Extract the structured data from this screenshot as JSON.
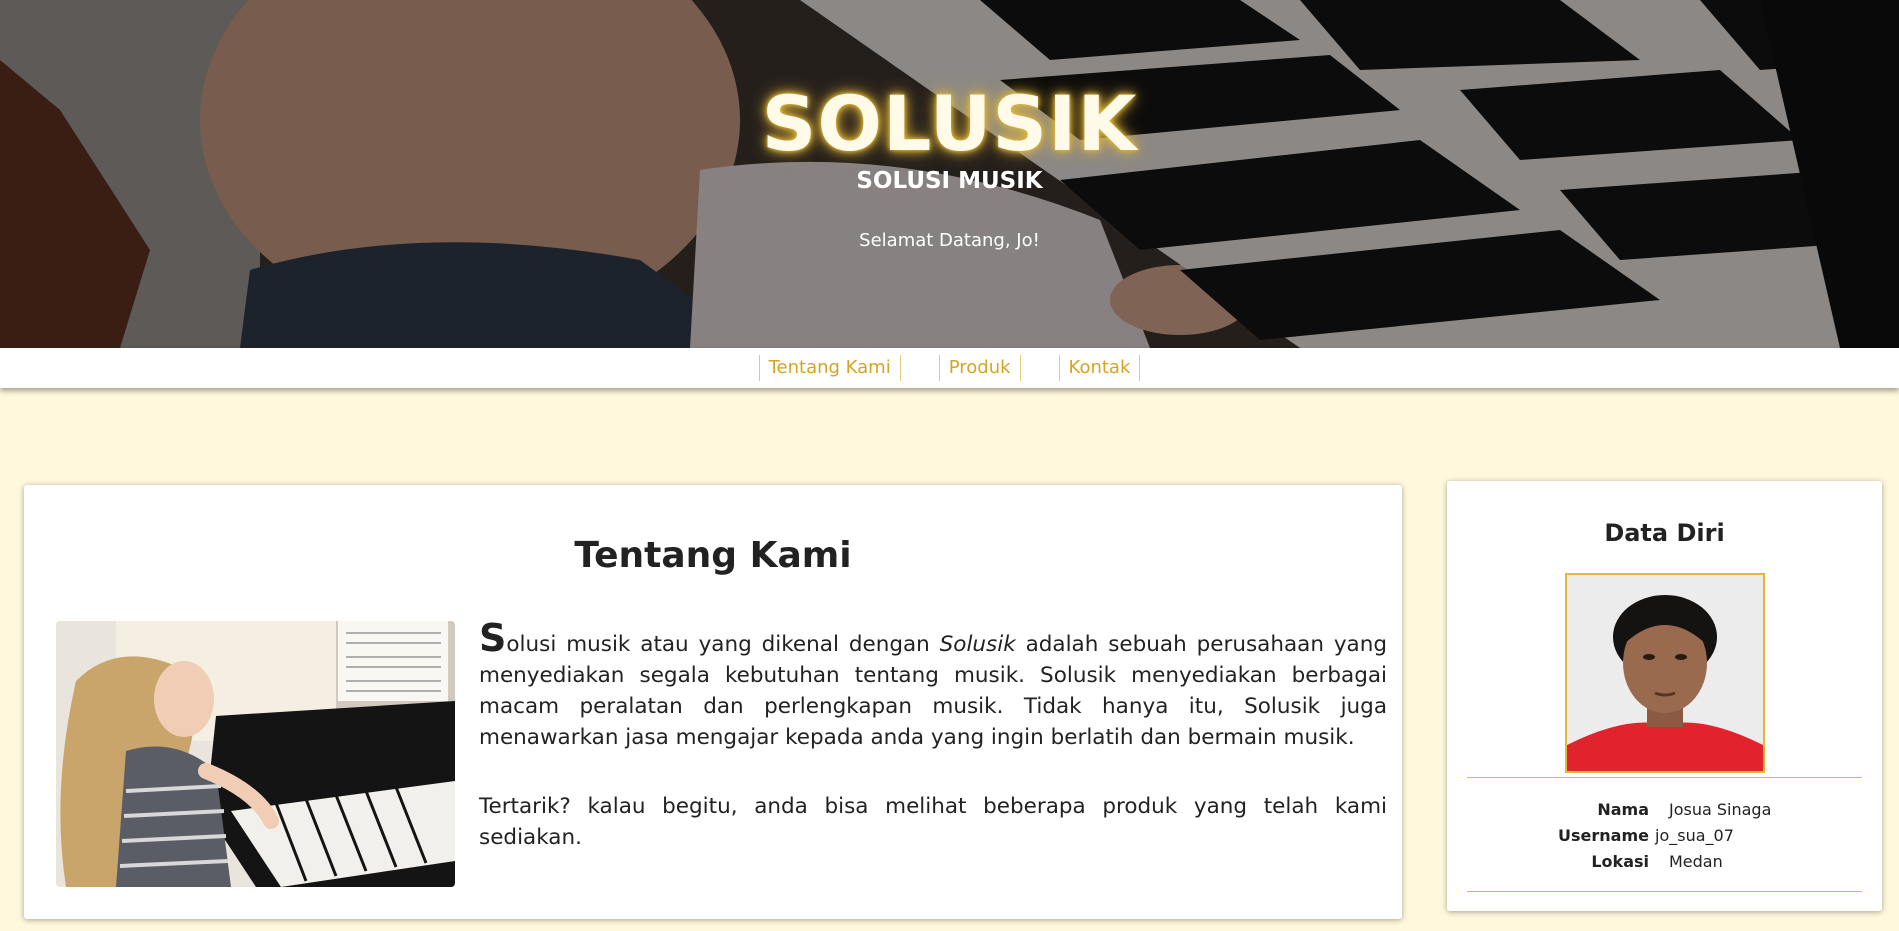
{
  "hero": {
    "title": "SOLUSIK",
    "subtitle": "SOLUSI MUSIK",
    "welcome": "Selamat Datang, Jo!"
  },
  "nav": {
    "items": [
      {
        "label": "Tentang Kami"
      },
      {
        "label": "Produk"
      },
      {
        "label": "Kontak"
      }
    ]
  },
  "about": {
    "title": "Tentang Kami",
    "dropcap": "S",
    "p1_a": "olusi musik atau yang dikenal dengan ",
    "p1_em": "Solusik",
    "p1_b": " adalah sebuah perusahaan yang menyediakan segala kebutuhan tentang musik. Solusik menyediakan berbagai macam peralatan dan perlengkapan musik. Tidak hanya itu, Solusik juga menawarkan jasa mengajar kepada anda yang ingin berlatih dan bermain musik.",
    "p2": "Tertarik? kalau begitu, anda bisa melihat beberapa produk yang telah kami sediakan."
  },
  "profile": {
    "title": "Data Diri",
    "fields": [
      {
        "label": "Nama",
        "value": "Josua Sinaga"
      },
      {
        "label": "Username",
        "value": "jo_sua_07"
      },
      {
        "label": "Lokasi",
        "value": "Medan"
      }
    ]
  },
  "colors": {
    "accent": "#d6a324",
    "background": "#fff8dd",
    "card": "#ffffff",
    "text": "#222222"
  }
}
